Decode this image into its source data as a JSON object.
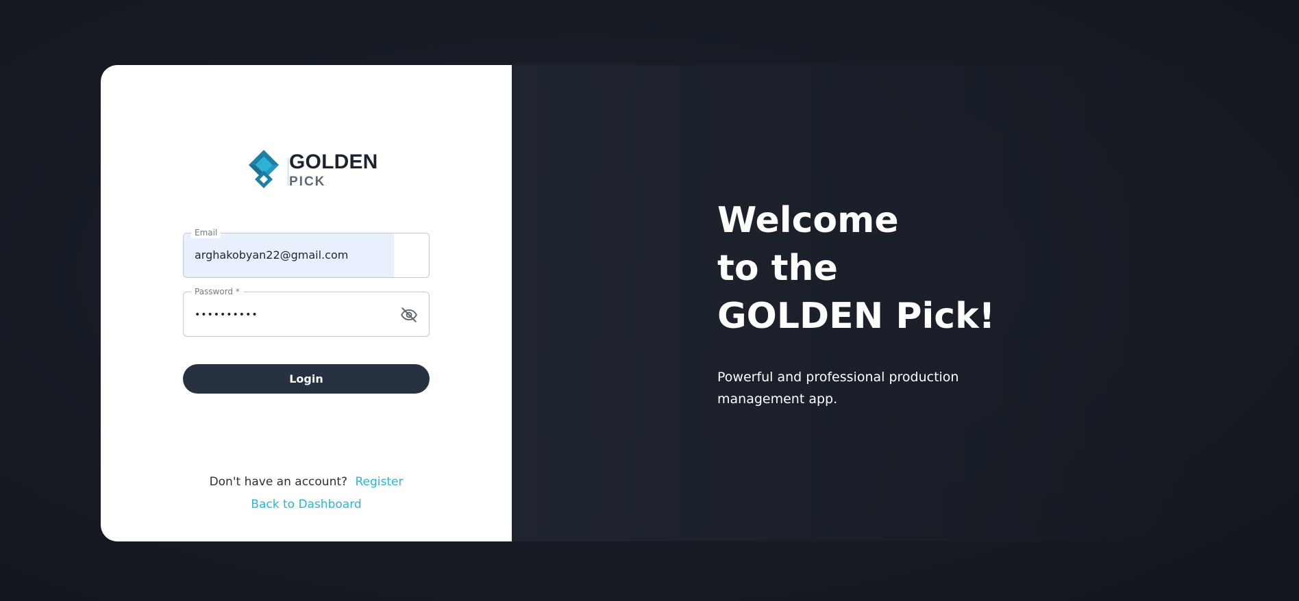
{
  "brand": {
    "title": "GOLDEN",
    "subtitle": "PICK",
    "colors": {
      "mark_dark": "#1b7fa6",
      "mark_light": "#2bb3d4",
      "accent": "#29b6d8"
    }
  },
  "login_form": {
    "email": {
      "label": "Email",
      "value": "arghakobyan22@gmail.com"
    },
    "password": {
      "label": "Password *",
      "value": "••••••••••",
      "toggle_icon": "eye-off-icon"
    },
    "login_label": "Login"
  },
  "footer": {
    "no_account_text": "Don't have an account?",
    "register_label": "Register",
    "back_label": "Back to Dashboard"
  },
  "hero": {
    "line1": "Welcome",
    "line2": "to the",
    "line3": "GOLDEN Pick!",
    "tagline": "Powerful and professional production management app."
  }
}
